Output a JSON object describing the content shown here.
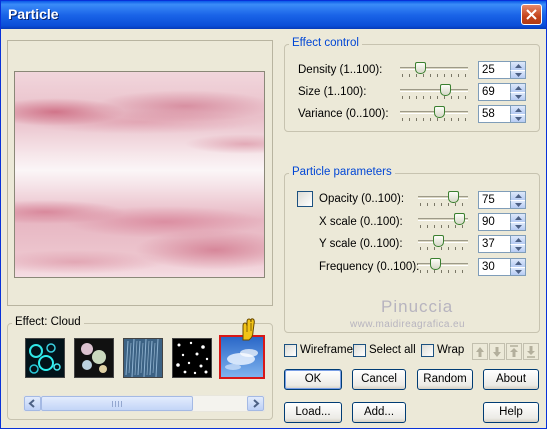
{
  "window": {
    "title": "Particle"
  },
  "effect_control": {
    "legend": "Effect control",
    "rows": [
      {
        "label": "Density (1..100):",
        "value": "25",
        "level": 0.25
      },
      {
        "label": "Size (1..100):",
        "value": "69",
        "level": 0.69
      },
      {
        "label": "Variance (0..100):",
        "value": "58",
        "level": 0.58
      }
    ]
  },
  "particle_parameters": {
    "legend": "Particle parameters",
    "rows": [
      {
        "label": "Opacity (0..100):",
        "value": "75",
        "level": 0.75
      },
      {
        "label": "X scale (0..100):",
        "value": "90",
        "level": 0.9
      },
      {
        "label": "Y scale (0..100):",
        "value": "37",
        "level": 0.37
      },
      {
        "label": "Frequency (0..100):",
        "value": "30",
        "level": 0.3
      }
    ]
  },
  "effect_group": {
    "legend": "Effect: Cloud",
    "thumbnails": [
      "bubbles",
      "sparkles",
      "rain",
      "stars",
      "cloud"
    ],
    "selected": "cloud"
  },
  "options": {
    "wireframe": "Wireframe",
    "select_all": "Select all",
    "wrap": "Wrap"
  },
  "buttons": {
    "ok": "OK",
    "cancel": "Cancel",
    "random": "Random",
    "about": "About",
    "load": "Load...",
    "add": "Add...",
    "help": "Help"
  },
  "watermark": {
    "line1": "Pinuccia",
    "line2": "www.maidireagrafica.eu"
  },
  "colors": {
    "title_bar": "#0a5ae8",
    "group_legend": "#0046d5",
    "selected_border": "#d81818",
    "slider_thumb": "#3a7f2f"
  }
}
